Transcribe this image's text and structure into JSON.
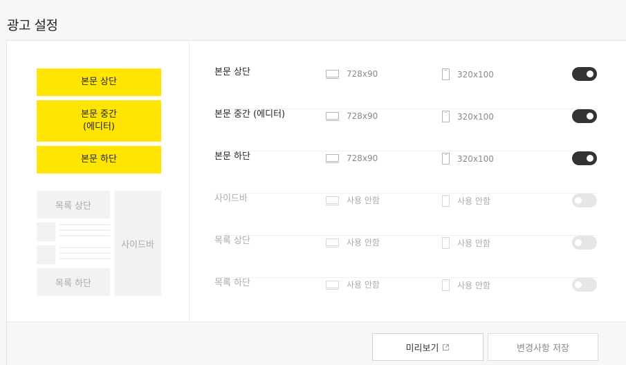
{
  "page": {
    "title": "광고 설정"
  },
  "preview": {
    "ad_top": "본문 상단",
    "ad_middle_line1": "본문 중간",
    "ad_middle_line2": "(에디터)",
    "ad_bottom": "본문 하단",
    "list_top": "목록 상단",
    "list_bottom": "목록 하단",
    "sidebar": "사이드바"
  },
  "rows": [
    {
      "label": "본문 상단",
      "pc": "728x90",
      "mobile": "320x100",
      "enabled": true
    },
    {
      "label": "본문 중간 (에디터)",
      "pc": "728x90",
      "mobile": "320x100",
      "enabled": true
    },
    {
      "label": "본문 하단",
      "pc": "728x90",
      "mobile": "320x100",
      "enabled": true
    },
    {
      "label": "사이드바",
      "pc": "사용 안함",
      "mobile": "사용 안함",
      "enabled": false
    },
    {
      "label": "목록 상단",
      "pc": "사용 안함",
      "mobile": "사용 안함",
      "enabled": false
    },
    {
      "label": "목록 하단",
      "pc": "사용 안함",
      "mobile": "사용 안함",
      "enabled": false
    }
  ],
  "footer": {
    "preview_label": "미리보기",
    "save_label": "변경사항 저장"
  },
  "icons": {
    "pc": "monitor-icon",
    "mobile": "mobile-icon",
    "external": "external-link-icon"
  },
  "colors": {
    "ad_yellow": "#ffe500",
    "toggle_on": "#333333",
    "toggle_off": "#e6e6e8"
  }
}
